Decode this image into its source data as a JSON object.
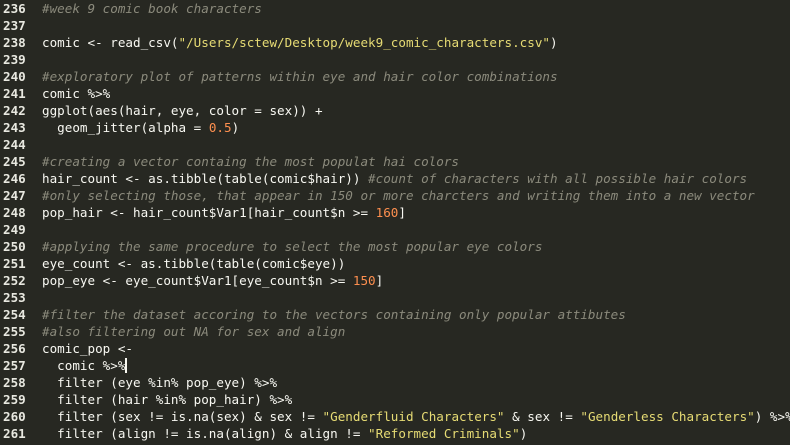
{
  "editor": {
    "lines": [
      {
        "number": "236",
        "tokens": [
          {
            "t": "#week 9 comic book characters",
            "k": "comment"
          }
        ]
      },
      {
        "number": "237",
        "tokens": []
      },
      {
        "number": "238",
        "tokens": [
          {
            "t": "comic <- read_csv(",
            "k": "plain"
          },
          {
            "t": "\"/Users/sctew/Desktop/week9_comic_characters.csv\"",
            "k": "string"
          },
          {
            "t": ")",
            "k": "plain"
          }
        ]
      },
      {
        "number": "239",
        "tokens": []
      },
      {
        "number": "240",
        "tokens": [
          {
            "t": "#exploratory plot of patterns within eye and hair color combinations",
            "k": "comment"
          }
        ]
      },
      {
        "number": "241",
        "tokens": [
          {
            "t": "comic %>%",
            "k": "plain"
          }
        ]
      },
      {
        "number": "242",
        "tokens": [
          {
            "t": "ggplot(aes(hair, eye, color = sex)) +",
            "k": "plain"
          }
        ]
      },
      {
        "number": "243",
        "tokens": [
          {
            "t": "  geom_jitter(alpha = ",
            "k": "plain"
          },
          {
            "t": "0.5",
            "k": "number"
          },
          {
            "t": ")",
            "k": "plain"
          }
        ]
      },
      {
        "number": "244",
        "tokens": []
      },
      {
        "number": "245",
        "tokens": [
          {
            "t": "#creating a vector containg the most populat hai colors",
            "k": "comment"
          }
        ]
      },
      {
        "number": "246",
        "tokens": [
          {
            "t": "hair_count <- as.tibble(table(comic$hair)) ",
            "k": "plain"
          },
          {
            "t": "#count of characters with all possible hair colors",
            "k": "comment"
          }
        ]
      },
      {
        "number": "247",
        "tokens": [
          {
            "t": "#only selecting those, that appear in 150 or more charcters and writing them into a new vector",
            "k": "comment"
          }
        ]
      },
      {
        "number": "248",
        "tokens": [
          {
            "t": "pop_hair <- hair_count$Var1[hair_count$n >= ",
            "k": "plain"
          },
          {
            "t": "160",
            "k": "number"
          },
          {
            "t": "]",
            "k": "plain"
          }
        ]
      },
      {
        "number": "249",
        "tokens": []
      },
      {
        "number": "250",
        "tokens": [
          {
            "t": "#applying the same procedure to select the most popular eye colors",
            "k": "comment"
          }
        ]
      },
      {
        "number": "251",
        "tokens": [
          {
            "t": "eye_count <- as.tibble(table(comic$eye))",
            "k": "plain"
          }
        ]
      },
      {
        "number": "252",
        "tokens": [
          {
            "t": "pop_eye <- eye_count$Var1[eye_count$n >= ",
            "k": "plain"
          },
          {
            "t": "150",
            "k": "number"
          },
          {
            "t": "]",
            "k": "plain"
          }
        ]
      },
      {
        "number": "253",
        "tokens": []
      },
      {
        "number": "254",
        "tokens": [
          {
            "t": "#filter the dataset accoring to the vectors containing only popular attibutes",
            "k": "comment"
          }
        ]
      },
      {
        "number": "255",
        "tokens": [
          {
            "t": "#also filtering out NA for sex and align",
            "k": "comment"
          }
        ]
      },
      {
        "number": "256",
        "tokens": [
          {
            "t": "comic_pop <-",
            "k": "plain"
          }
        ]
      },
      {
        "number": "257",
        "tokens": [
          {
            "t": "  comic %>%",
            "k": "plain"
          }
        ],
        "cursor": true
      },
      {
        "number": "258",
        "tokens": [
          {
            "t": "  filter (eye %in% pop_eye) %>%",
            "k": "plain"
          }
        ]
      },
      {
        "number": "259",
        "tokens": [
          {
            "t": "  filter (hair %in% pop_hair) %>%",
            "k": "plain"
          }
        ]
      },
      {
        "number": "260",
        "tokens": [
          {
            "t": "  filter (sex != is.na(sex) & sex != ",
            "k": "plain"
          },
          {
            "t": "\"Genderfluid Characters\"",
            "k": "string"
          },
          {
            "t": " & sex != ",
            "k": "plain"
          },
          {
            "t": "\"Genderless Characters\"",
            "k": "string"
          },
          {
            "t": ") %>%",
            "k": "plain"
          }
        ]
      },
      {
        "number": "261",
        "tokens": [
          {
            "t": "  filter (align != is.na(align) & align != ",
            "k": "plain"
          },
          {
            "t": "\"Reformed Criminals\"",
            "k": "string"
          },
          {
            "t": ")",
            "k": "plain"
          }
        ]
      }
    ]
  }
}
